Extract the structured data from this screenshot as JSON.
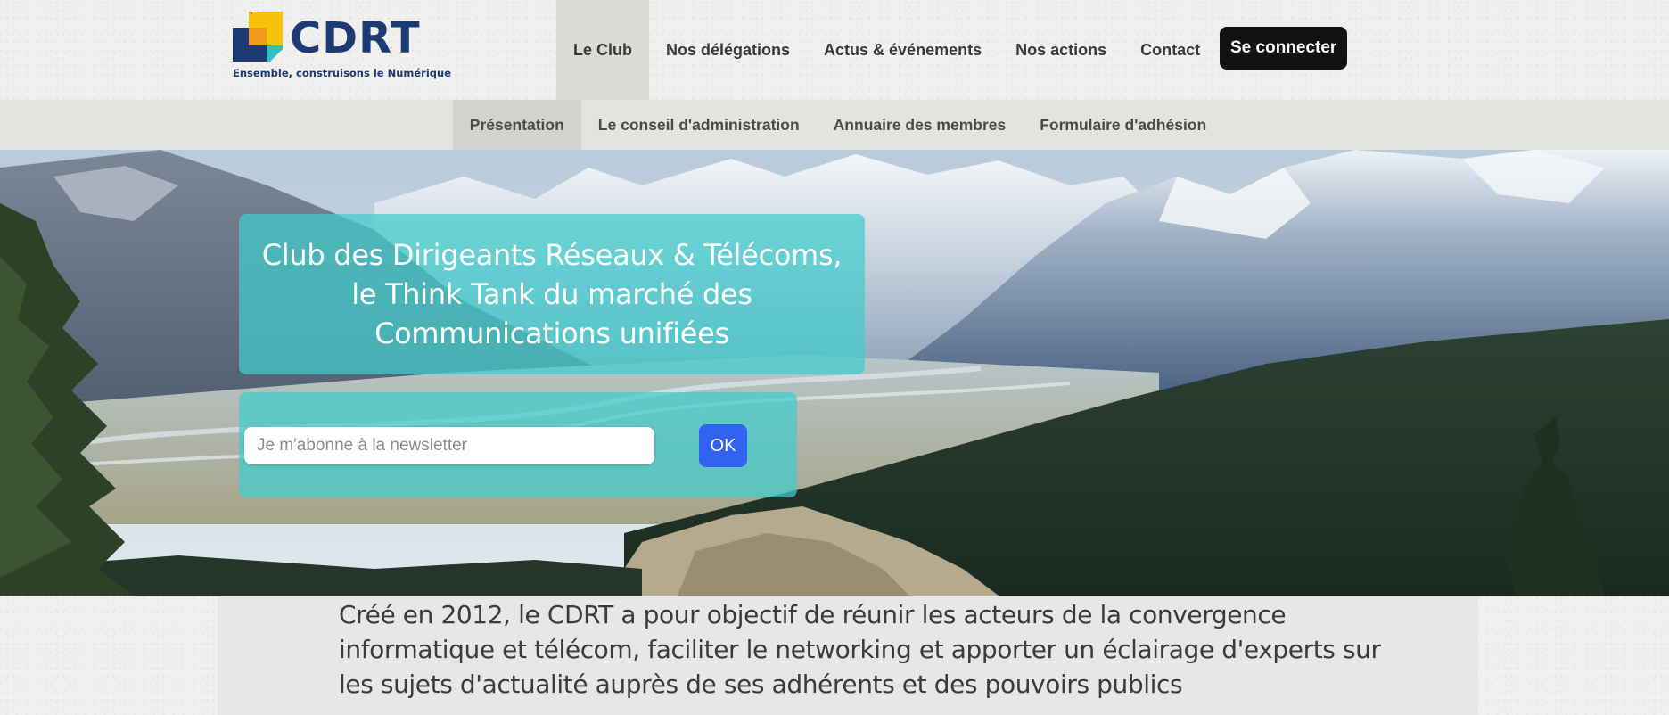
{
  "brand": {
    "name": "CDRT",
    "tagline": "Ensemble, construisons le Numérique",
    "colors": {
      "navy": "#1d3a73",
      "orange": "#f39a1b",
      "yellow": "#f6c20d",
      "teal": "#36bcc6"
    }
  },
  "mainnav": {
    "items": [
      {
        "label": "Le Club",
        "active": true
      },
      {
        "label": "Nos délégations",
        "active": false
      },
      {
        "label": "Actus & événements",
        "active": false
      },
      {
        "label": "Nos actions",
        "active": false
      },
      {
        "label": "Contact",
        "active": false
      }
    ],
    "login_label": "Se connecter"
  },
  "subnav": {
    "items": [
      {
        "label": "Présentation",
        "active": true
      },
      {
        "label": "Le conseil d'administration",
        "active": false
      },
      {
        "label": "Annuaire des membres",
        "active": false
      },
      {
        "label": "Formulaire d'adhésion",
        "active": false
      }
    ]
  },
  "hero": {
    "title_line1": "Club des Dirigeants Réseaux & Télécoms,",
    "title_line2": "le Think Tank du marché des",
    "title_line3": "Communications unifiées",
    "background": "mountain-landscape-image"
  },
  "newsletter": {
    "placeholder": "Je m'abonne à la newsletter",
    "value": "",
    "submit_label": "OK",
    "accent": "#2f63f0"
  },
  "intro": {
    "text": "Créé en 2012, le CDRT a pour objectif de réunir les acteurs de la convergence informatique et télécom, faciliter le networking et apporter un éclairage d'experts sur les sujets d'actualité auprès de ses adhérents et des pouvoirs publics"
  }
}
